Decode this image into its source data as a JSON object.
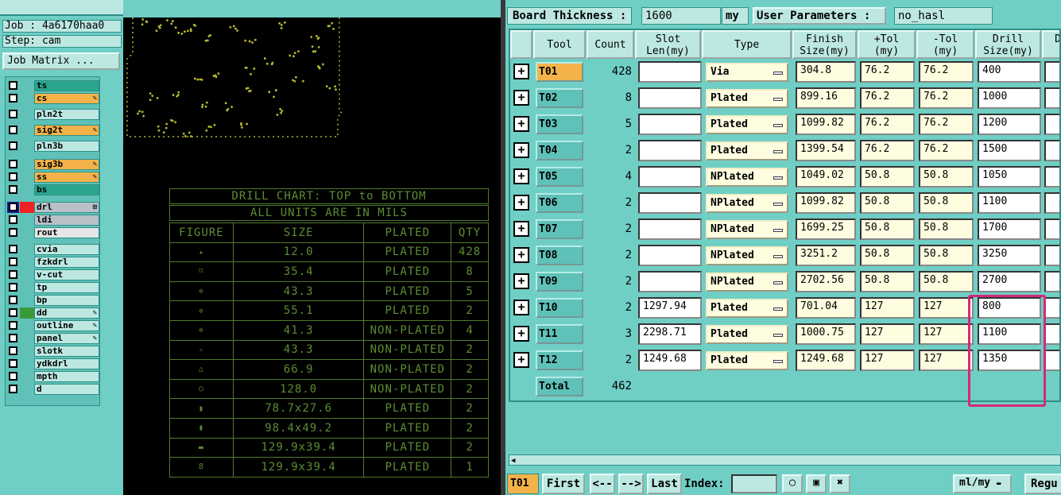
{
  "left": {
    "job": "Job : 4a6170haa0",
    "step": "Step: cam",
    "job_matrix_label": "Job Matrix ...",
    "layers": [
      {
        "name": "ts",
        "color": "#2aa58e",
        "flag": ""
      },
      {
        "name": "cs",
        "color": "#f3b34a",
        "flag": "✎"
      },
      {
        "name": "pln2t",
        "color": "#bde8e2",
        "flag": ""
      },
      {
        "name": "sig2t",
        "color": "#f3b34a",
        "flag": "✎"
      },
      {
        "name": "pln3b",
        "color": "#bde8e2",
        "flag": ""
      },
      {
        "name": "sig3b",
        "color": "#f3b34a",
        "flag": "✎"
      },
      {
        "name": "ss",
        "color": "#f3b34a",
        "flag": "✎"
      },
      {
        "name": "bs",
        "color": "#2aa58e",
        "flag": ""
      },
      {
        "name": "drl",
        "color": "#b9c0c8",
        "flag": "⊞"
      },
      {
        "name": "ldi",
        "color": "#b9c0c8",
        "flag": ""
      },
      {
        "name": "rout",
        "color": "#e6e6e6",
        "flag": ""
      },
      {
        "name": "cvia",
        "color": "#bde8e2",
        "flag": ""
      },
      {
        "name": "fzkdrl",
        "color": "#bde8e2",
        "flag": ""
      },
      {
        "name": "v-cut",
        "color": "#bde8e2",
        "flag": ""
      },
      {
        "name": "tp",
        "color": "#bde8e2",
        "flag": ""
      },
      {
        "name": "bp",
        "color": "#bde8e2",
        "flag": ""
      },
      {
        "name": "dd",
        "color": "#bde8e2",
        "flag": "✎"
      },
      {
        "name": "outline",
        "color": "#bde8e2",
        "flag": "✎"
      },
      {
        "name": "panel",
        "color": "#bde8e2",
        "flag": "✎"
      },
      {
        "name": "slotk",
        "color": "#bde8e2",
        "flag": ""
      },
      {
        "name": "ydkdrl",
        "color": "#bde8e2",
        "flag": ""
      },
      {
        "name": "mpth",
        "color": "#bde8e2",
        "flag": ""
      },
      {
        "name": "d",
        "color": "#bde8e2",
        "flag": ""
      }
    ]
  },
  "drill_chart": {
    "title": "DRILL CHART: TOP to BOTTOM",
    "units": "ALL UNITS ARE IN MILS",
    "headers": [
      "FIGURE",
      "SIZE",
      "PLATED",
      "QTY"
    ],
    "rows": [
      {
        "figure": "▴",
        "size": "12.0",
        "plated": "PLATED",
        "qty": "428"
      },
      {
        "figure": "⌑",
        "size": "35.4",
        "plated": "PLATED",
        "qty": "8"
      },
      {
        "figure": "✲",
        "size": "43.3",
        "plated": "PLATED",
        "qty": "5"
      },
      {
        "figure": "✲",
        "size": "55.1",
        "plated": "PLATED",
        "qty": "2"
      },
      {
        "figure": "✲",
        "size": "41.3",
        "plated": "NON-PLATED",
        "qty": "4"
      },
      {
        "figure": "✧",
        "size": "43.3",
        "plated": "NON-PLATED",
        "qty": "2"
      },
      {
        "figure": "△",
        "size": "66.9",
        "plated": "NON-PLATED",
        "qty": "2"
      },
      {
        "figure": "○",
        "size": "128.0",
        "plated": "NON-PLATED",
        "qty": "2"
      },
      {
        "figure": "▮",
        "size": "78.7x27.6",
        "plated": "PLATED",
        "qty": "2"
      },
      {
        "figure": "▮",
        "size": "98.4x49.2",
        "plated": "PLATED",
        "qty": "2"
      },
      {
        "figure": "▬",
        "size": "129.9x39.4",
        "plated": "PLATED",
        "qty": "2"
      },
      {
        "figure": "8",
        "size": "129.9x39.4",
        "plated": "PLATED",
        "qty": "1"
      }
    ]
  },
  "right": {
    "board_thickness_label": "Board Thickness :",
    "board_thickness_value": "1600",
    "board_thickness_unit": "my",
    "user_params_label": "User Parameters :",
    "user_params_value": "no_hasl",
    "headers": [
      "Tool",
      "Count",
      "Slot\nLen(my)",
      "Type",
      "Finish\nSize(my)",
      "+Tol\n(my)",
      "-Tol\n(my)",
      "Drill\nSize(my)",
      "D"
    ],
    "rows": [
      {
        "tool": "T01",
        "count": "428",
        "slot": "",
        "type": "Via",
        "finish": "304.8",
        "ptol": "76.2",
        "ntol": "76.2",
        "drill": "400",
        "icon": "A"
      },
      {
        "tool": "T02",
        "count": "8",
        "slot": "",
        "type": "Plated",
        "finish": "899.16",
        "ptol": "76.2",
        "ntol": "76.2",
        "drill": "1000",
        "icon": "B"
      },
      {
        "tool": "T03",
        "count": "5",
        "slot": "",
        "type": "Plated",
        "finish": "1099.82",
        "ptol": "76.2",
        "ntol": "76.2",
        "drill": "1200",
        "icon": "C"
      },
      {
        "tool": "T04",
        "count": "2",
        "slot": "",
        "type": "Plated",
        "finish": "1399.54",
        "ptol": "76.2",
        "ntol": "76.2",
        "drill": "1500",
        "icon": "D"
      },
      {
        "tool": "T05",
        "count": "4",
        "slot": "",
        "type": "NPlated",
        "finish": "1049.02",
        "ptol": "50.8",
        "ntol": "50.8",
        "drill": "1050",
        "icon": "E"
      },
      {
        "tool": "T06",
        "count": "2",
        "slot": "",
        "type": "NPlated",
        "finish": "1099.82",
        "ptol": "50.8",
        "ntol": "50.8",
        "drill": "1100",
        "icon": "F"
      },
      {
        "tool": "T07",
        "count": "2",
        "slot": "",
        "type": "NPlated",
        "finish": "1699.25",
        "ptol": "50.8",
        "ntol": "50.8",
        "drill": "1700",
        "icon": "G"
      },
      {
        "tool": "T08",
        "count": "2",
        "slot": "",
        "type": "NPlated",
        "finish": "3251.2",
        "ptol": "50.8",
        "ntol": "50.8",
        "drill": "3250",
        "icon": "H"
      },
      {
        "tool": "T09",
        "count": "2",
        "slot": "",
        "type": "NPlated",
        "finish": "2702.56",
        "ptol": "50.8",
        "ntol": "50.8",
        "drill": "2700",
        "icon": "I"
      },
      {
        "tool": "T10",
        "count": "2",
        "slot": "1297.94",
        "type": "Plated",
        "finish": "701.04",
        "ptol": "127",
        "ntol": "127",
        "drill": "800",
        "icon": "J"
      },
      {
        "tool": "T11",
        "count": "3",
        "slot": "2298.71",
        "type": "Plated",
        "finish": "1000.75",
        "ptol": "127",
        "ntol": "127",
        "drill": "1100",
        "icon": "K"
      },
      {
        "tool": "T12",
        "count": "2",
        "slot": "1249.68",
        "type": "Plated",
        "finish": "1249.68",
        "ptol": "127",
        "ntol": "127",
        "drill": "1350",
        "icon": "L"
      }
    ],
    "total_label": "Total",
    "total_count": "462",
    "bottom": {
      "current_tool": "T01",
      "first": "First",
      "prev": "<--",
      "next": "-->",
      "last": "Last",
      "index_label": "Index:",
      "unit_select": "ml/my",
      "regu": "Regu"
    }
  },
  "colors": {
    "selected": "#f3b34a",
    "highlight": "#d4287a",
    "canvas": "#000000",
    "trace": "#b8b830"
  }
}
